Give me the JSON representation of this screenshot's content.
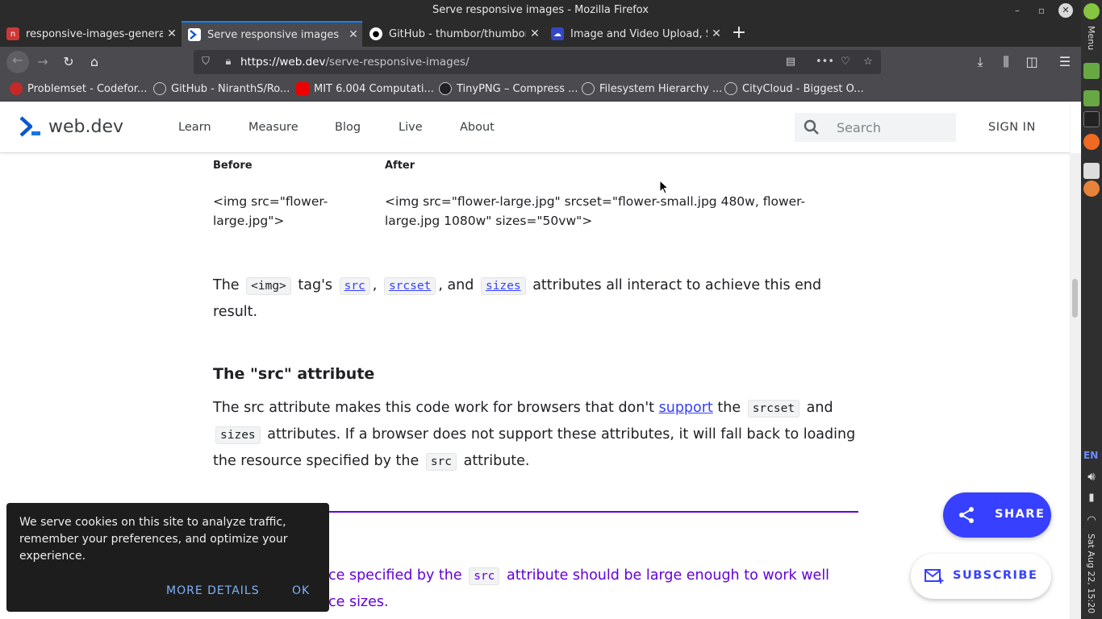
{
  "window": {
    "title": "Serve responsive images - Mozilla Firefox"
  },
  "tabs": [
    {
      "label": "responsive-images-generat",
      "icon": "npm-icon"
    },
    {
      "label": "Serve responsive images",
      "icon": "webdev-icon"
    },
    {
      "label": "GitHub - thumbor/thumbor",
      "icon": "github-icon"
    },
    {
      "label": "Image and Video Upload, S",
      "icon": "cloudinary-icon"
    }
  ],
  "navbar": {
    "url_host": "https://web.dev",
    "url_path": "/serve-responsive-images/"
  },
  "bookmarks": [
    {
      "label": "Problemset - Codefor..."
    },
    {
      "label": "GitHub - NiranthS/Ro..."
    },
    {
      "label": "MIT 6.004 Computati..."
    },
    {
      "label": "TinyPNG – Compress ..."
    },
    {
      "label": "Filesystem Hierarchy ..."
    },
    {
      "label": "CityCloud - Biggest O..."
    }
  ],
  "dock": {
    "menu_label": "Menu",
    "lang": "EN",
    "clock": "Sat Aug 22, 15:20"
  },
  "site": {
    "logo_text": "web.dev",
    "nav": [
      "Learn",
      "Measure",
      "Blog",
      "Live",
      "About"
    ],
    "search_placeholder": "Search",
    "signin": "SIGN IN"
  },
  "article": {
    "table": {
      "headers": [
        "Before",
        "After"
      ],
      "before": "<img src=\"flower-large.jpg\">",
      "after": "<img src=\"flower-large.jpg\" srcset=\"flower-small.jpg 480w, flower-large.jpg 1080w\" sizes=\"50vw\">"
    },
    "p1": {
      "t1": "The",
      "c1": "<img>",
      "t2": "tag's",
      "c2": "src",
      "t3": ",",
      "c3": "srcset",
      "t4": ", and",
      "c4": "sizes",
      "t5": "attributes all interact to achieve this end result."
    },
    "h_src": "The \"src\" attribute",
    "p2": {
      "t1": "The src attribute makes this code work for browsers that don't",
      "link": "support",
      "t2": "the",
      "c1": "srcset",
      "t3": "and",
      "c2": "sizes",
      "t4": "attributes. If a browser does not support these attributes, it will fall back to loading the resource specified by the",
      "c3": "src",
      "t5": "attribute."
    },
    "callout": {
      "t1": "ce specified by the",
      "c1": "src",
      "t2": "attribute should be large enough to work well",
      "t3": "ce sizes."
    }
  },
  "cookie": {
    "message": "We serve cookies on this site to analyze traffic, remember your preferences, and optimize your experience.",
    "more": "MORE DETAILS",
    "ok": "OK"
  },
  "fab": {
    "share": "SHARE",
    "subscribe": "SUBSCRIBE"
  },
  "colors": {
    "accent": "#3740ff",
    "callout": "#6400d8",
    "tab_highlight": "#0a84ff"
  }
}
